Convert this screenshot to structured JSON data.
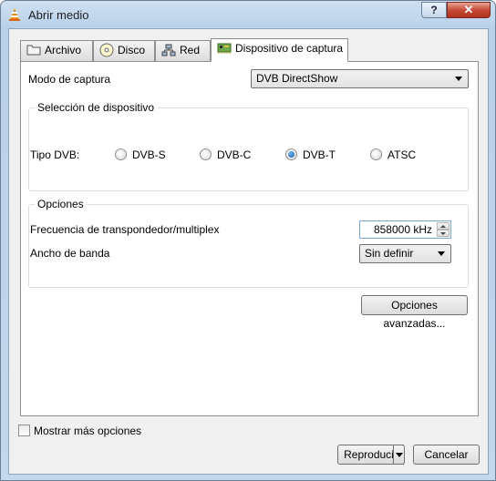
{
  "window": {
    "title": "Abrir medio",
    "help_label": "?",
    "close_label": "✕"
  },
  "tabs": [
    {
      "label": "Archivo",
      "icon": "folder-icon"
    },
    {
      "label": "Disco",
      "icon": "disc-icon"
    },
    {
      "label": "Red",
      "icon": "network-icon"
    },
    {
      "label": "Dispositivo de captura",
      "icon": "capture-card-icon",
      "active": true
    }
  ],
  "capture": {
    "mode_label": "Modo de captura",
    "mode_value": "DVB DirectShow"
  },
  "device_group": {
    "title": "Selección de dispositivo",
    "dvb_type_label": "Tipo DVB:",
    "options": [
      {
        "label": "DVB-S",
        "selected": false
      },
      {
        "label": "DVB-C",
        "selected": false
      },
      {
        "label": "DVB-T",
        "selected": true
      },
      {
        "label": "ATSC",
        "selected": false
      }
    ]
  },
  "options_group": {
    "title": "Opciones",
    "frequency_label": "Frecuencia de transpondedor/multiplex",
    "frequency_value": "858000 kHz",
    "bandwidth_label": "Ancho de banda",
    "bandwidth_value": "Sin definir"
  },
  "advanced_button": "Opciones avanzadas...",
  "footer": {
    "more_options_label": "Mostrar más opciones",
    "play_button": "Reproducir",
    "cancel_button": "Cancelar"
  },
  "colors": {
    "accent": "#1a5fae",
    "title_bar": "#b9d1ea",
    "close": "#c54b36"
  }
}
